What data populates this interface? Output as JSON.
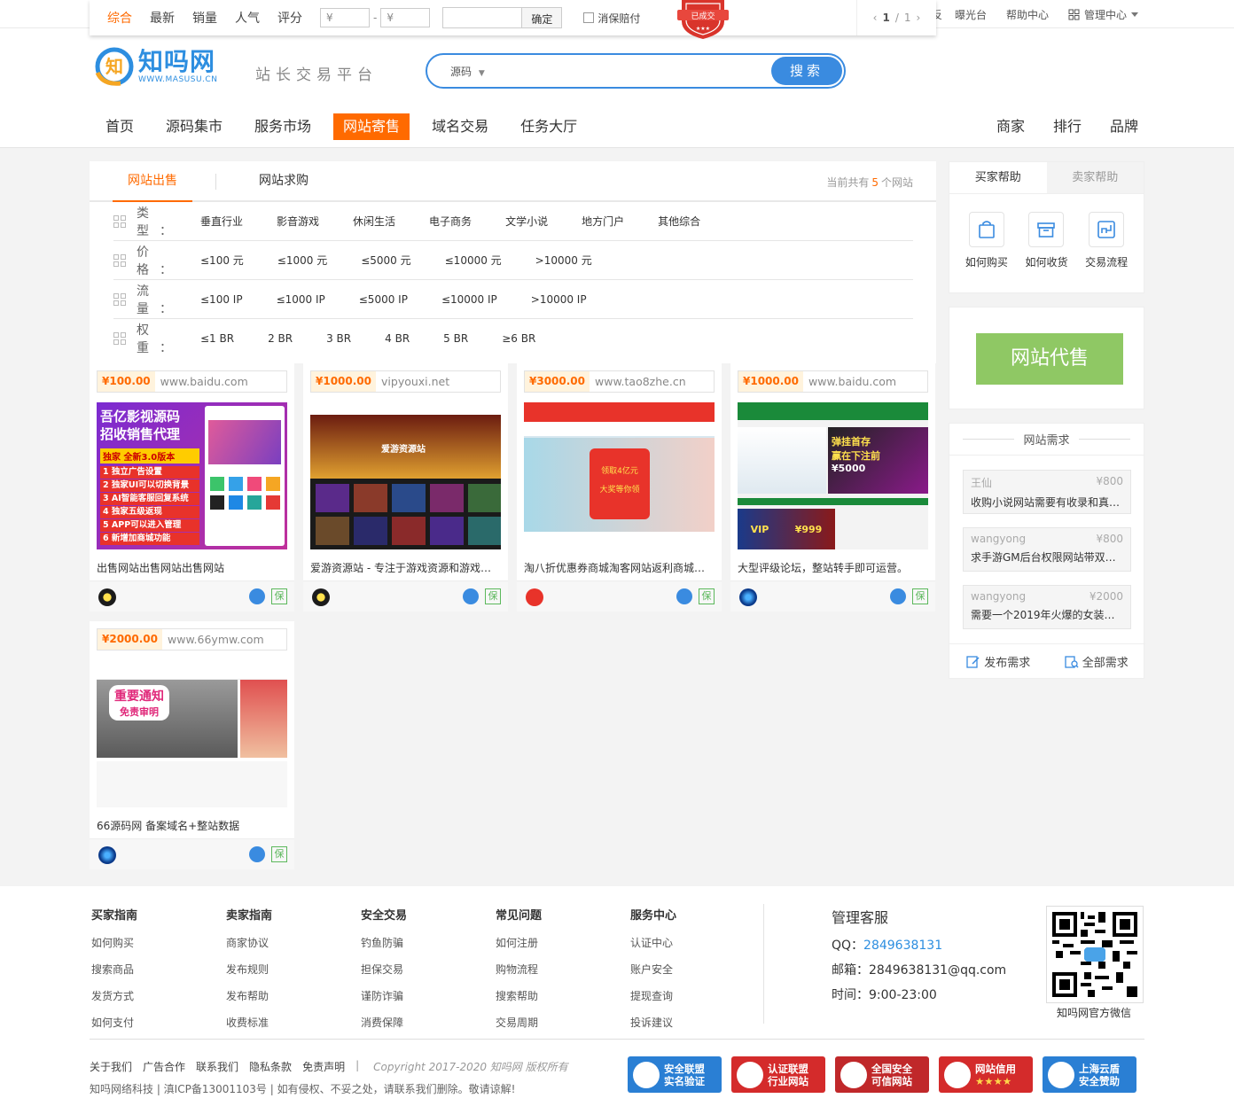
{
  "topbar": {
    "links": [
      "曝光台",
      "帮助中心"
    ],
    "manage": "管理中心",
    "cut_char": "反"
  },
  "sortbar": {
    "sorts": [
      "综合",
      "最新",
      "销量",
      "人气",
      "评分"
    ],
    "price_from_placeholder": "¥",
    "price_to_placeholder": "¥",
    "price_dash": "-",
    "confirm": "确定",
    "guarantee": "消保赔付",
    "seal_text": "已成交",
    "pager": {
      "current": "1",
      "total": "1"
    }
  },
  "header": {
    "logo_cn": "知吗网",
    "logo_en": "WWW.MASUSU.CN",
    "slogan": "站长交易平台",
    "search": {
      "category": "源码",
      "button": "搜索"
    },
    "nav": [
      "首页",
      "源码集市",
      "服务市场",
      "网站寄售",
      "域名交易",
      "任务大厅"
    ],
    "nav_active_index": 3,
    "nav_right": [
      "商家",
      "排行",
      "品牌"
    ]
  },
  "filters": {
    "tabs": [
      "网站出售",
      "网站求购"
    ],
    "count_prefix": "当前共有",
    "count": "5",
    "count_suffix": "个网站",
    "rows": [
      {
        "label": "类型：",
        "options": [
          "垂直行业",
          "影音游戏",
          "休闲生活",
          "电子商务",
          "文学小说",
          "地方门户",
          "其他综合"
        ]
      },
      {
        "label": "价格：",
        "options": [
          "≤100 元",
          "≤1000 元",
          "≤5000 元",
          "≤10000 元",
          ">10000 元"
        ]
      },
      {
        "label": "流量：",
        "options": [
          "≤100 IP",
          "≤1000 IP",
          "≤5000 IP",
          "≤10000 IP",
          ">10000 IP"
        ]
      },
      {
        "label": "权重：",
        "options": [
          "≤1 BR",
          "2 BR",
          "3 BR",
          "4 BR",
          "5 BR",
          "≥6 BR"
        ]
      }
    ]
  },
  "listings": [
    {
      "price": "¥100.00",
      "domain": "www.baidu.com",
      "title": "出售网站出售网站出售网站",
      "thumb_text": [
        "吾亿影视源码",
        "招收销售代理",
        "独家 全新3.0版本",
        "1 独立广告设置",
        "2 独家UI可以切换背景",
        "3 AI智能客服回复系统",
        "4 独家五级返现",
        "5 APP可以进入管理",
        "6 新增加商城功能"
      ],
      "guarantee": "保"
    },
    {
      "price": "¥1000.00",
      "domain": "vipyouxi.net",
      "title": "爱游资源站 - 专注于游戏资源和游戏源码",
      "thumb_text": [
        "爱游资源站"
      ],
      "guarantee": "保"
    },
    {
      "price": "¥3000.00",
      "domain": "www.tao8zhe.cn",
      "title": "淘八折优惠券商城淘客网站返利商城带APP",
      "thumb_text": [
        "领取4亿元",
        "大奖等你领"
      ],
      "guarantee": "保"
    },
    {
      "price": "¥1000.00",
      "domain": "www.baidu.com",
      "title": "大型评级论坛，整站转手即可运营。",
      "thumb_text": [
        "弹挂首存",
        "赢在下注前",
        "¥5000",
        "VIP",
        "¥999"
      ],
      "guarantee": "保"
    },
    {
      "price": "¥2000.00",
      "domain": "www.66ymw.com",
      "title": "66源码网 备案域名+整站数据",
      "thumb_text": [
        "重要通知",
        "免责审明"
      ],
      "guarantee": "保"
    }
  ],
  "sidebar": {
    "help_tabs": [
      "买家帮助",
      "卖家帮助"
    ],
    "helps": [
      "如何购买",
      "如何收货",
      "交易流程"
    ],
    "consign_button": "网站代售",
    "needs_title": "网站需求",
    "needs": [
      {
        "user": "王仙",
        "price": "¥800",
        "text": "收购小说网站需要有收录和真实流量"
      },
      {
        "user": "wangyong",
        "price": "¥800",
        "text": "求手游GM后台权限网站带双端源码"
      },
      {
        "user": "wangyong",
        "price": "¥2000",
        "text": "需要一个2019年火爆的女装特卖网站"
      }
    ],
    "need_actions": [
      "发布需求",
      "全部需求"
    ]
  },
  "footer": {
    "columns": [
      {
        "title": "买家指南",
        "links": [
          "如何购买",
          "搜索商品",
          "发货方式",
          "如何支付"
        ]
      },
      {
        "title": "卖家指南",
        "links": [
          "商家协议",
          "发布规则",
          "发布帮助",
          "收费标准"
        ]
      },
      {
        "title": "安全交易",
        "links": [
          "钓鱼防骗",
          "担保交易",
          "谨防诈骗",
          "消费保障"
        ]
      },
      {
        "title": "常见问题",
        "links": [
          "如何注册",
          "购物流程",
          "搜索帮助",
          "交易周期"
        ]
      },
      {
        "title": "服务中心",
        "links": [
          "认证中心",
          "账户安全",
          "提现查询",
          "投诉建议"
        ]
      }
    ],
    "service": {
      "title": "管理客服",
      "qq_label": "QQ：",
      "qq": "2849638131",
      "email": "邮箱：2849638131@qq.com",
      "time": "时间：9:00-23:00"
    },
    "qr_caption": "知吗网官方微信",
    "links": [
      "关于我们",
      "广告合作",
      "联系我们",
      "隐私条款",
      "免责声明"
    ],
    "sep": "|",
    "copyright": "Copyright 2017-2020 知吗网 版权所有",
    "company": "知吗网络科技 | 滇ICP备13001103号 | 如有侵权、不妥之处，请联系我们删除。敬请谅解!",
    "badges": [
      {
        "line1": "安全联盟",
        "line2": "实名验证",
        "color": "#2a7fd4"
      },
      {
        "line1": "认证联盟",
        "line2": "行业网站",
        "color": "#d42b2b"
      },
      {
        "line1": "全国安全",
        "line2": "可信网站",
        "color": "#c0282a"
      },
      {
        "line1": "网站信用",
        "line2": "★★★★",
        "color": "#d42b2b"
      },
      {
        "line1": "上海云盾",
        "line2": "安全赞助",
        "color": "#2a7fd4"
      }
    ]
  }
}
